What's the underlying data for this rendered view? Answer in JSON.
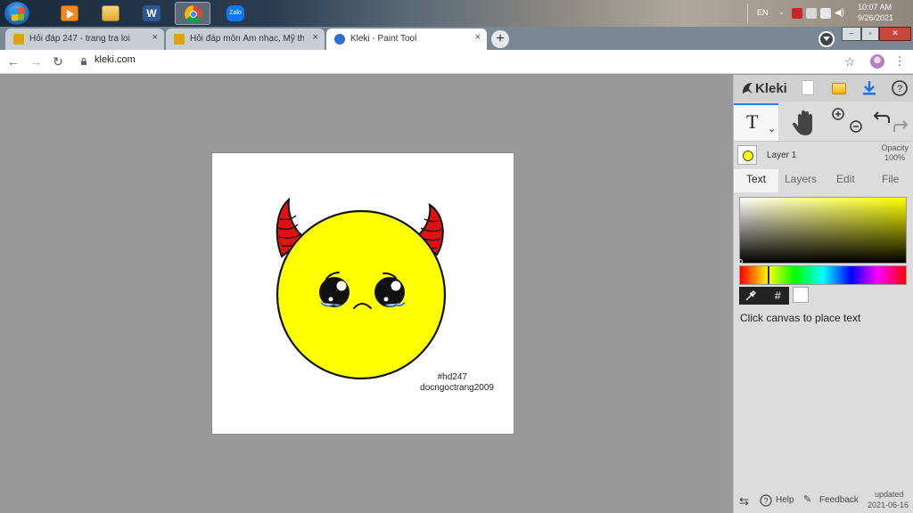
{
  "taskbar": {
    "apps": [
      {
        "name": "start-button"
      },
      {
        "name": "media-player"
      },
      {
        "name": "file-explorer"
      },
      {
        "name": "word"
      },
      {
        "name": "chrome"
      },
      {
        "name": "zalo",
        "label": "Zalo"
      }
    ],
    "tray": {
      "lang": "EN",
      "time": "10:07 AM",
      "date": "9/26/2021"
    }
  },
  "browser": {
    "tabs": [
      {
        "label": "Hỏi đáp 247 - trang tra loi",
        "close": "×"
      },
      {
        "label": "Hỏi đáp môn Âm nhạc, Mỹ thuật",
        "close": "×"
      },
      {
        "label": "Kleki - Paint Tool",
        "close": "×"
      }
    ],
    "new_tab": "+",
    "url": "kleki.com",
    "window_controls": {
      "min": "–",
      "max": "▫",
      "close": "✕"
    }
  },
  "kleki": {
    "brand": "Kleki",
    "tools": {
      "text_tool": "T",
      "caret": "⌄"
    },
    "layer": {
      "name": "Layer 1",
      "opacity_label": "Opacity",
      "opacity_value": "100%"
    },
    "tabs": [
      "Text",
      "Layers",
      "Edit",
      "File"
    ],
    "active_tab": "Text",
    "picker_hash": "#",
    "hint": "Click canvas to place text",
    "footer": {
      "help": "Help",
      "feedback": "Feedback",
      "updated_label": "updated",
      "updated_date": "2021-06-16"
    }
  },
  "canvas": {
    "signature_line1": "#hd247",
    "signature_line2": "docngoctrang2009"
  },
  "colors": {
    "face": "#ffff00",
    "horns": "#e11010",
    "accent": "#2b7fd6"
  }
}
